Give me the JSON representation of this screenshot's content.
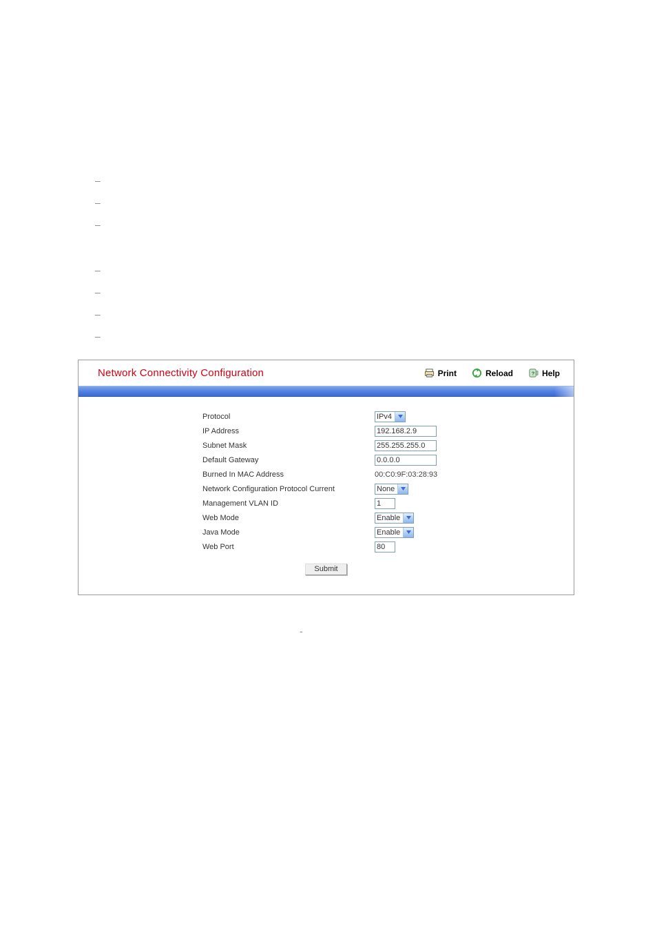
{
  "panel": {
    "title": "Network Connectivity Configuration",
    "actions": {
      "print": "Print",
      "reload": "Reload",
      "help": "Help"
    }
  },
  "form": {
    "protocol": {
      "label": "Protocol",
      "value": "IPv4"
    },
    "ipAddress": {
      "label": "IP Address",
      "value": "192.168.2.9"
    },
    "subnetMask": {
      "label": "Subnet Mask",
      "value": "255.255.255.0"
    },
    "defaultGateway": {
      "label": "Default Gateway",
      "value": "0.0.0.0"
    },
    "mac": {
      "label": "Burned In MAC Address",
      "value": "00:C0:9F:03:28:93"
    },
    "netConfigProto": {
      "label": "Network Configuration Protocol Current",
      "value": "None"
    },
    "vlanId": {
      "label": "Management VLAN ID",
      "value": "1"
    },
    "webMode": {
      "label": "Web Mode",
      "value": "Enable"
    },
    "javaMode": {
      "label": "Java Mode",
      "value": "Enable"
    },
    "webPort": {
      "label": "Web Port",
      "value": "80"
    }
  },
  "buttons": {
    "submit": "Submit"
  }
}
